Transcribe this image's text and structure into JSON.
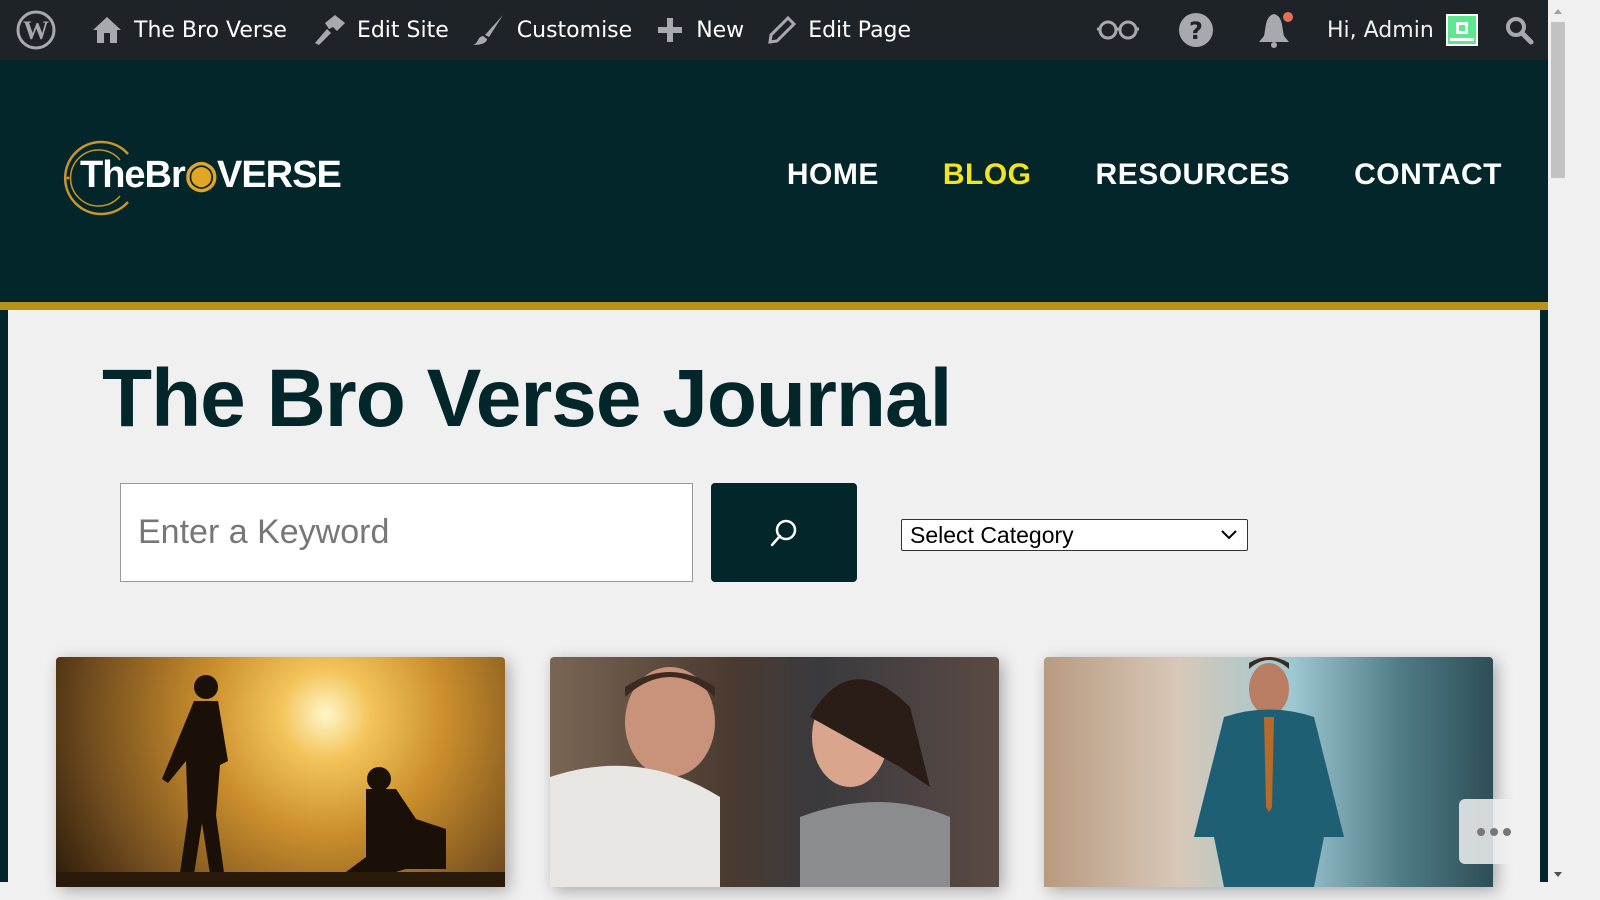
{
  "admin_bar": {
    "site_name": "The Bro Verse",
    "edit_site": "Edit Site",
    "customise": "Customise",
    "new": "New",
    "edit_page": "Edit Page",
    "greeting": "Hi, Admin",
    "icons": [
      "wordpress-icon",
      "home-icon",
      "hammer-icon",
      "brush-icon",
      "plus-icon",
      "pencil-icon",
      "glasses-icon",
      "help-icon",
      "bell-icon",
      "search-icon"
    ],
    "notification_color": "#e26f56"
  },
  "header": {
    "logo_text": "TheBroVERSE",
    "nav": [
      {
        "label": "HOME"
      },
      {
        "label": "BLOG",
        "active": true
      },
      {
        "label": "RESOURCES"
      },
      {
        "label": "CONTACT"
      }
    ],
    "bg_color": "#03262a",
    "accent_color": "#b8921a",
    "active_color": "#f5e31b"
  },
  "main": {
    "title": "The Bro Verse Journal",
    "search_placeholder": "Enter a Keyword",
    "category_select": "Select Category"
  }
}
